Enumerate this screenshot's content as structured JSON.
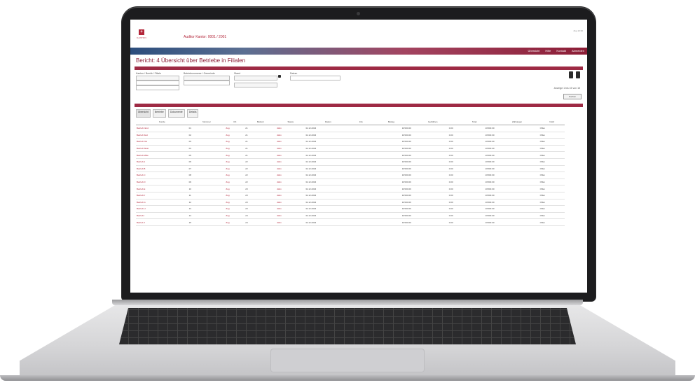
{
  "app": {
    "logo_text": "KANTON",
    "user_line": "Auditor Kantor: 0001 / 2001",
    "right_info": "Zug\n10:30"
  },
  "nav": [
    "Übersicht",
    "Hilfe",
    "Kontakt",
    "Abmelden"
  ],
  "page_title": "Bericht: 4 Übersicht über Betriebe in Filialen",
  "filters": {
    "labels": [
      "Kanton / Bezirk / Filiale",
      "Betriebsnummer / Gemeinde",
      "Stand",
      "Datum"
    ],
    "info_text": "Anzeige 1 bis 15 von 15"
  },
  "search_button": "Suchen",
  "tabs": [
    "Übersicht",
    "Betriebe",
    "Dokumente",
    "Details"
  ],
  "table": {
    "columns": [
      "Kunde",
      "Nummer",
      "Ort",
      "Betrieb",
      "Status",
      "Datum",
      "Info",
      "Betrag",
      "Gebühren",
      "Total",
      "Zahlungen",
      "Notiz"
    ],
    "rows": [
      [
        "Betrieb Nord",
        "01",
        "Zug",
        "21",
        "Aktiv",
        "31.12.2023",
        "",
        "10'000.00",
        "0.00",
        "10'000.00",
        "",
        "Offen"
      ],
      [
        "Betrieb Süd",
        "02",
        "Zug",
        "21",
        "Aktiv",
        "31.12.2023",
        "",
        "10'000.00",
        "0.00",
        "10'000.00",
        "",
        "Offen"
      ],
      [
        "Betrieb Ost",
        "03",
        "Zug",
        "21",
        "Aktiv",
        "31.12.2023",
        "",
        "10'000.00",
        "0.00",
        "10'000.00",
        "",
        "Offen"
      ],
      [
        "Betrieb West",
        "04",
        "Zug",
        "21",
        "Aktiv",
        "31.12.2023",
        "",
        "10'000.00",
        "0.00",
        "10'000.00",
        "",
        "Offen"
      ],
      [
        "Betrieb Mitte",
        "05",
        "Zug",
        "21",
        "Aktiv",
        "31.12.2023",
        "",
        "10'000.00",
        "0.00",
        "10'000.00",
        "",
        "Offen"
      ],
      [
        "Betrieb A",
        "06",
        "Zug",
        "22",
        "Aktiv",
        "31.12.2023",
        "",
        "10'000.00",
        "0.00",
        "10'000.00",
        "",
        "Offen"
      ],
      [
        "Betrieb B",
        "07",
        "Zug",
        "22",
        "Aktiv",
        "31.12.2023",
        "",
        "10'000.00",
        "0.00",
        "10'000.00",
        "",
        "Offen"
      ],
      [
        "Betrieb C",
        "08",
        "Zug",
        "22",
        "Aktiv",
        "31.12.2023",
        "",
        "10'000.00",
        "0.00",
        "10'000.00",
        "",
        "Offen"
      ],
      [
        "Betrieb D",
        "09",
        "Zug",
        "22",
        "Aktiv",
        "31.12.2023",
        "",
        "10'000.00",
        "0.00",
        "10'000.00",
        "",
        "Offen"
      ],
      [
        "Betrieb E",
        "10",
        "Zug",
        "23",
        "Aktiv",
        "31.12.2023",
        "",
        "10'000.00",
        "0.00",
        "10'000.00",
        "",
        "Offen"
      ],
      [
        "Betrieb F",
        "11",
        "Zug",
        "23",
        "Aktiv",
        "31.12.2023",
        "",
        "10'000.00",
        "0.00",
        "10'000.00",
        "",
        "Offen"
      ],
      [
        "Betrieb G",
        "12",
        "Zug",
        "23",
        "Aktiv",
        "31.12.2023",
        "",
        "10'000.00",
        "0.00",
        "10'000.00",
        "",
        "Offen"
      ],
      [
        "Betrieb H",
        "13",
        "Zug",
        "23",
        "Aktiv",
        "31.12.2023",
        "",
        "10'000.00",
        "0.00",
        "10'000.00",
        "",
        "Offen"
      ],
      [
        "Betrieb I",
        "14",
        "Zug",
        "24",
        "Aktiv",
        "31.12.2023",
        "",
        "10'000.00",
        "0.00",
        "10'000.00",
        "",
        "Offen"
      ],
      [
        "Betrieb J",
        "15",
        "Zug",
        "24",
        "Aktiv",
        "31.12.2023",
        "",
        "10'000.00",
        "0.00",
        "10'000.00",
        "",
        "Offen"
      ]
    ]
  }
}
